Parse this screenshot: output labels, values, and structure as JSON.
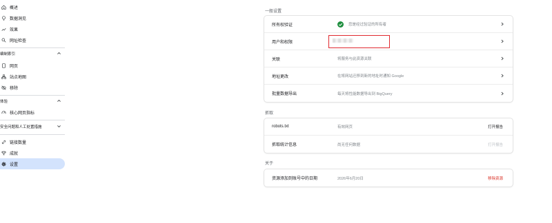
{
  "sidebar": {
    "items_top": [
      {
        "label": "概述",
        "icon": "home-icon"
      },
      {
        "label": "数据洞见",
        "icon": "lightbulb-icon"
      },
      {
        "label": "效果",
        "icon": "trending-up-icon"
      },
      {
        "label": "网址检查",
        "icon": "search-icon"
      }
    ],
    "index_section": {
      "title": "编制索引",
      "items": [
        {
          "label": "网页",
          "icon": "pages-icon"
        },
        {
          "label": "站点地图",
          "icon": "sitemap-icon"
        },
        {
          "label": "移除",
          "icon": "visibility-off-icon"
        }
      ]
    },
    "experience_section": {
      "title": "体验",
      "items": [
        {
          "label": "核心网页指标",
          "icon": "speed-icon"
        }
      ]
    },
    "security_section": {
      "title": "安全问题和人工处置措施"
    },
    "items_bottom": [
      {
        "label": "链接数量",
        "icon": "link-icon"
      },
      {
        "label": "成就",
        "icon": "trophy-icon"
      },
      {
        "label": "设置",
        "icon": "gear-icon",
        "active": true
      }
    ]
  },
  "general": {
    "title": "一般设置",
    "rows": [
      {
        "label": "所有权验证",
        "value": "您是经过验证的所有者"
      },
      {
        "label": "用户和权限",
        "value": ""
      },
      {
        "label": "关联",
        "value": "将服务与此资源关联"
      },
      {
        "label": "地址更改",
        "value": "在将网站迁移到新的地址时通知 Google"
      },
      {
        "label": "批量数据导出",
        "value": "每天将性能数据导出到 BigQuery"
      }
    ]
  },
  "crawl": {
    "title": "抓取",
    "rows": [
      {
        "label": "robots.txt",
        "value": "有效网页",
        "action": "打开报告"
      },
      {
        "label": "抓取统计信息",
        "value": "尚无任何数据",
        "action": "打开报告"
      }
    ]
  },
  "about": {
    "title": "关于",
    "rows": [
      {
        "label": "资源添加到账号中的日期",
        "value": "2026年6月20日",
        "action": "移除资源"
      }
    ]
  },
  "colors": {
    "accent_active": "#d3e3fd",
    "check_green": "#1e8e3e",
    "danger": "#d93025"
  }
}
